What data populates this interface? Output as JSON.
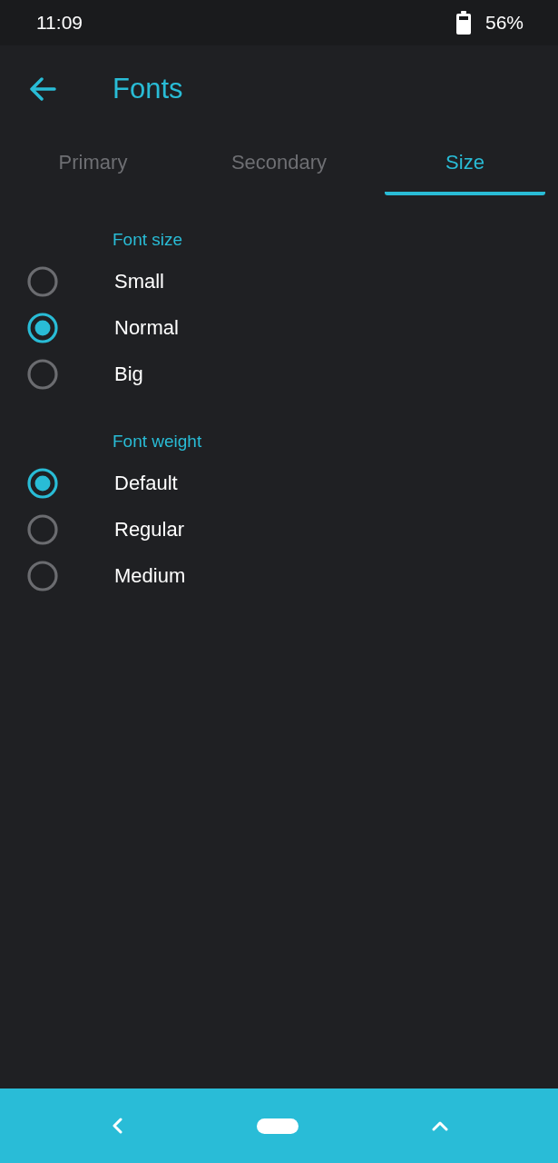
{
  "status_bar": {
    "time": "11:09",
    "battery": "56%"
  },
  "app_bar": {
    "title": "Fonts"
  },
  "tabs": [
    {
      "label": "Primary",
      "selected": false
    },
    {
      "label": "Secondary",
      "selected": false
    },
    {
      "label": "Size",
      "selected": true
    }
  ],
  "sections": [
    {
      "heading": "Font size",
      "options": [
        {
          "label": "Small",
          "selected": false
        },
        {
          "label": "Normal",
          "selected": true
        },
        {
          "label": "Big",
          "selected": false
        }
      ]
    },
    {
      "heading": "Font weight",
      "options": [
        {
          "label": "Default",
          "selected": true
        },
        {
          "label": "Regular",
          "selected": false
        },
        {
          "label": "Medium",
          "selected": false
        }
      ]
    }
  ]
}
